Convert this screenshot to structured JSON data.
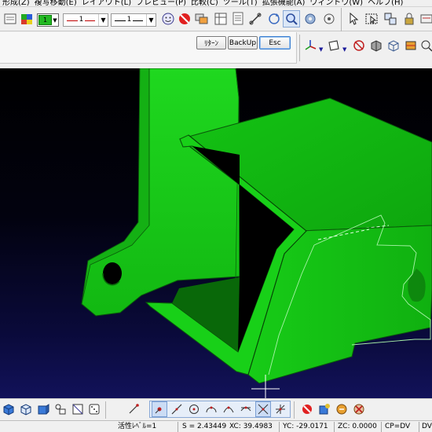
{
  "menu": {
    "items": [
      "形成(Z)",
      "複写移動(E)",
      "レイアウト(L)",
      "プレビュー(P)",
      "比較(C)",
      "ツール(T)",
      "拡張機能(A)",
      "ウィンドウ(W)",
      "ヘルプ(H)"
    ]
  },
  "toolbar": {
    "color_value": "1",
    "line_type_value": "1",
    "line_width_value": "1"
  },
  "command_bar": {
    "return_label": "ﾘﾀｰﾝ",
    "backup_label": "BackUp",
    "esc_label": "Esc"
  },
  "viewport": {
    "background_top": "#000000",
    "background_bottom": "#12125a",
    "model_color": "#18d818",
    "model_shade": "#0fa80f",
    "edge_color": "#0a4a0a"
  },
  "status": {
    "active_level": "活性ﾚﾍﾞﾙ=1",
    "scale": "S = 2.43449",
    "xc": "XC: 39.4983",
    "yc": "YC: -29.0171",
    "zc": "ZC: 0.0000",
    "cp": "CP=DV",
    "dv": "DV"
  },
  "icons": {
    "toolbar": [
      "color-swatch-icon",
      "stamp-icon",
      "face-icon",
      "no-entry-icon",
      "properties-icon",
      "extended-functions-icon",
      "layer-icon",
      "measure-icon",
      "rotate-view-icon",
      "zoom-icon",
      "select-icon",
      "snap-icon"
    ],
    "bottom": [
      "cube-icon",
      "cube-outline-icon",
      "box-icon",
      "list-icon",
      "grid-icon",
      "dice-icon",
      "pick-icon",
      "point-icon",
      "line-icon",
      "circle-icon",
      "arc-icon",
      "spline-icon",
      "intersect-icon",
      "cross-icon",
      "cross-alt-icon",
      "no-entry-icon",
      "paint-icon",
      "transform-icon",
      "gear-icon",
      "erase-icon"
    ]
  }
}
